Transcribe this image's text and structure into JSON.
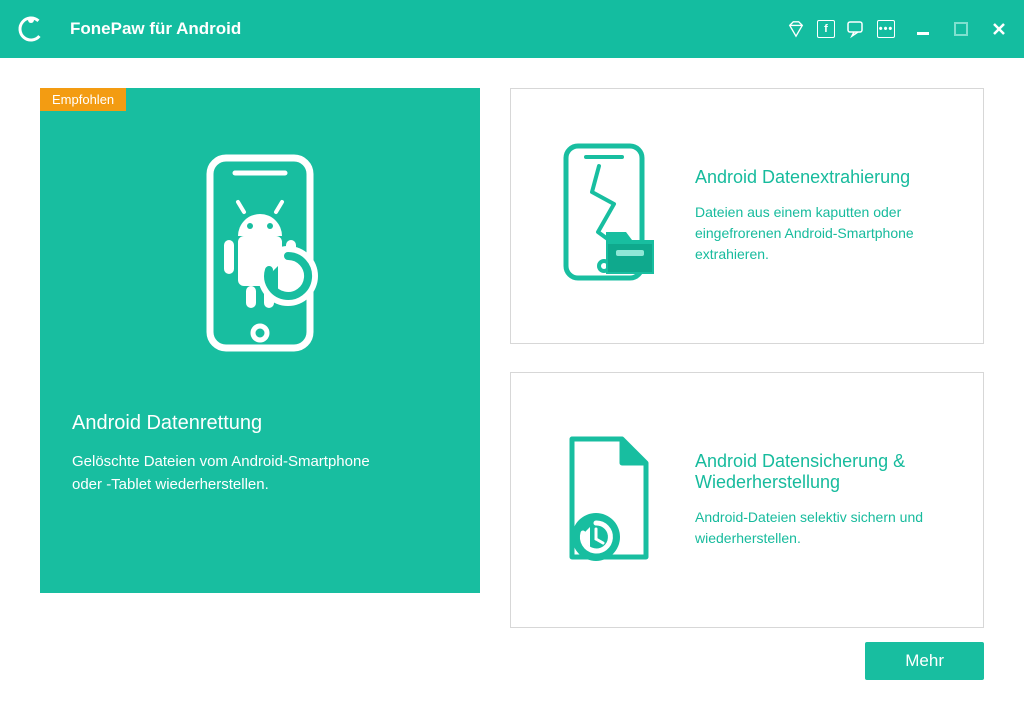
{
  "titlebar": {
    "app_title": "FonePaw für Android"
  },
  "badge_label": "Empfohlen",
  "cards": {
    "recovery": {
      "title": "Android Datenrettung",
      "desc": "Gelöschte Dateien vom Android-Smartphone oder -Tablet wiederherstellen."
    },
    "extraction": {
      "title": "Android Datenextrahierung",
      "desc": "Dateien aus einem kaputten oder eingefrorenen Android-Smartphone extrahieren."
    },
    "backup": {
      "title": "Android Datensicherung & Wiederherstellung",
      "desc": "Android-Dateien selektiv sichern und wiederherstellen."
    }
  },
  "footer": {
    "more_label": "Mehr"
  },
  "colors": {
    "accent": "#18bea0",
    "badge": "#f39c12"
  }
}
